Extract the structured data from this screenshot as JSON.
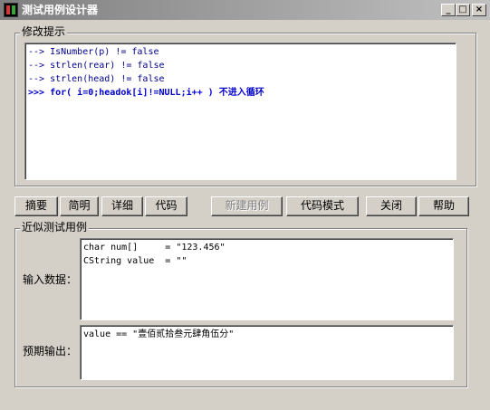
{
  "window": {
    "title": "测试用例设计器"
  },
  "title_buttons": {
    "minimize": "_",
    "maximize": "□",
    "close": "×"
  },
  "hints": {
    "legend": "修改提示",
    "lines": [
      {
        "prefix": "-->",
        "text": " IsNumber(p) != false"
      },
      {
        "prefix": "-->",
        "text": " strlen(rear) != false"
      },
      {
        "prefix": "-->",
        "text": " strlen(head) != false"
      },
      {
        "prefix": ">>>",
        "text": " for( i=0;headok[i]!=NULL;i++ ) 不进入循环"
      }
    ]
  },
  "toolbar": {
    "summary": "摘要",
    "brief": "简明",
    "detail": "详细",
    "code": "代码",
    "new_case": "新建用例",
    "code_mode": "代码模式",
    "close": "关闭",
    "help": "帮助"
  },
  "similar": {
    "legend": "近似测试用例",
    "input_label": "输入数据：",
    "input_value": "char num[]     = \"123.456\"\nCString value  = \"\"",
    "output_label": "预期输出：",
    "output_value": "value == \"壹佰贰拾叁元肆角伍分\""
  }
}
